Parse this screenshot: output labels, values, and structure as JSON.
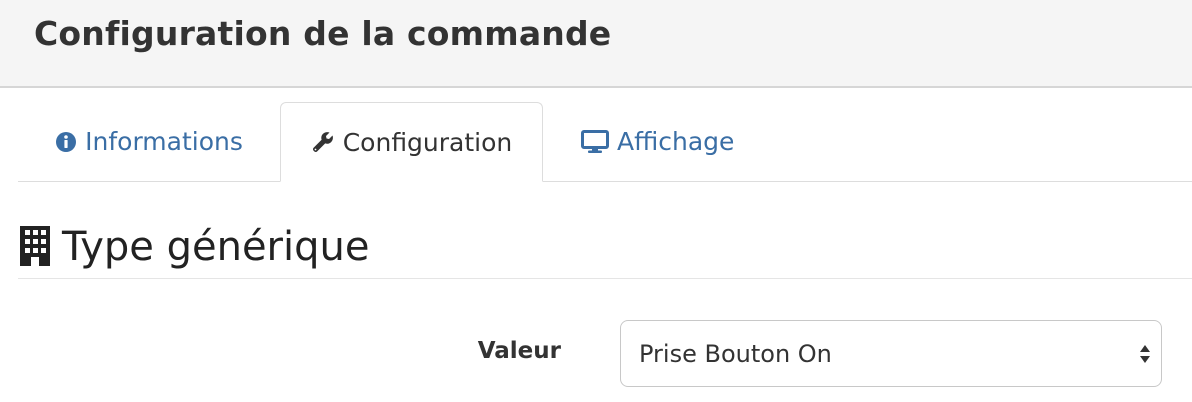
{
  "modal": {
    "title": "Configuration de la commande"
  },
  "tabs": [
    {
      "label": "Informations",
      "icon": "info-circle-icon",
      "active": false
    },
    {
      "label": "Configuration",
      "icon": "wrench-icon",
      "active": true
    },
    {
      "label": "Affichage",
      "icon": "monitor-icon",
      "active": false
    }
  ],
  "section": {
    "title": "Type générique",
    "icon": "building-icon"
  },
  "field": {
    "label": "Valeur",
    "selected": "Prise Bouton On",
    "icon": "sort-arrows-icon"
  },
  "colors": {
    "link": "#3a6ea5",
    "text": "#333333",
    "header_bg": "#f5f5f5"
  }
}
